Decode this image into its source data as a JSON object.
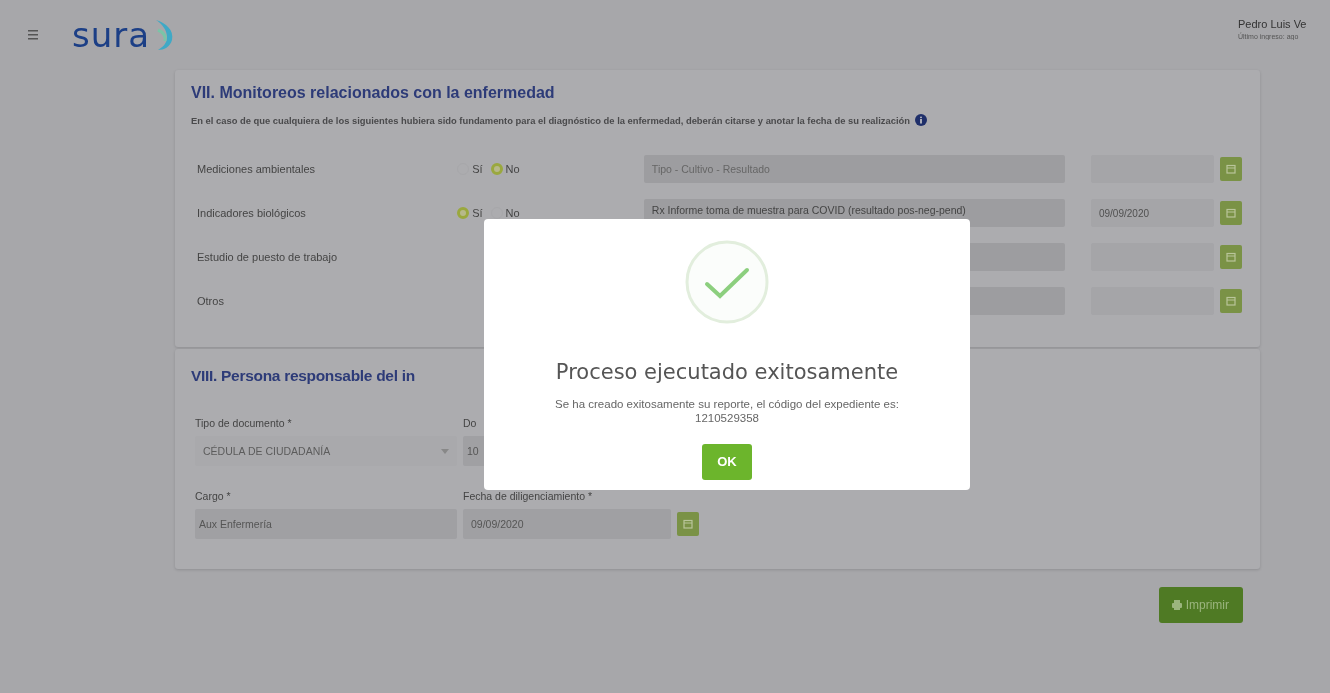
{
  "header": {
    "logo": "sura",
    "user_name": "Pedro Luis Ve",
    "last_login": "Último ingreso: ago"
  },
  "section_vii": {
    "title": "VII. Monitoreos relacionados con la enfermedad",
    "description": "En el caso de que cualquiera de los siguientes hubiera sido fundamento para el diagnóstico de la enfermedad, deberán citarse y anotar la fecha de su realización",
    "rows": [
      {
        "label": "Mediciones ambientales",
        "options": [
          {
            "label": "Sí",
            "selected": false
          },
          {
            "label": "No",
            "selected": true
          }
        ],
        "detail": {
          "placeholder": "Tipo - Cultivo - Resultado"
        }
      },
      {
        "label": "Indicadores biológicos",
        "options": [
          {
            "label": "Sí",
            "selected": true
          },
          {
            "label": "No",
            "selected": false
          }
        ],
        "detail": {
          "value": "Rx Informe toma de muestra para COVID (resultado pos-neg-pend)"
        },
        "date": "09/09/2020"
      },
      {
        "label": "Estudio de puesto de trabajo",
        "detail": {}
      },
      {
        "label": "Otros",
        "detail": {}
      }
    ]
  },
  "section_viii": {
    "title": "VIII. Persona responsable del in",
    "fields": [
      {
        "kind": "select",
        "label": "Tipo de documento *",
        "value": "CÉDULA DE CIUDADANÍA"
      },
      {
        "kind": "text",
        "label": "Do",
        "value": "10"
      },
      {
        "kind": "text",
        "label": "Cargo *",
        "value": "Aux Enfermería"
      },
      {
        "kind": "date",
        "label": "Fecha de diligenciamiento *",
        "value": "09/09/2020"
      }
    ]
  },
  "print_button": {
    "label": "Imprimir"
  },
  "dialog": {
    "title": "Proceso ejecutado exitosamente",
    "message": "Se ha creado exitosamente su reporte, el código del expediente es: 1210529358",
    "button": "OK"
  }
}
